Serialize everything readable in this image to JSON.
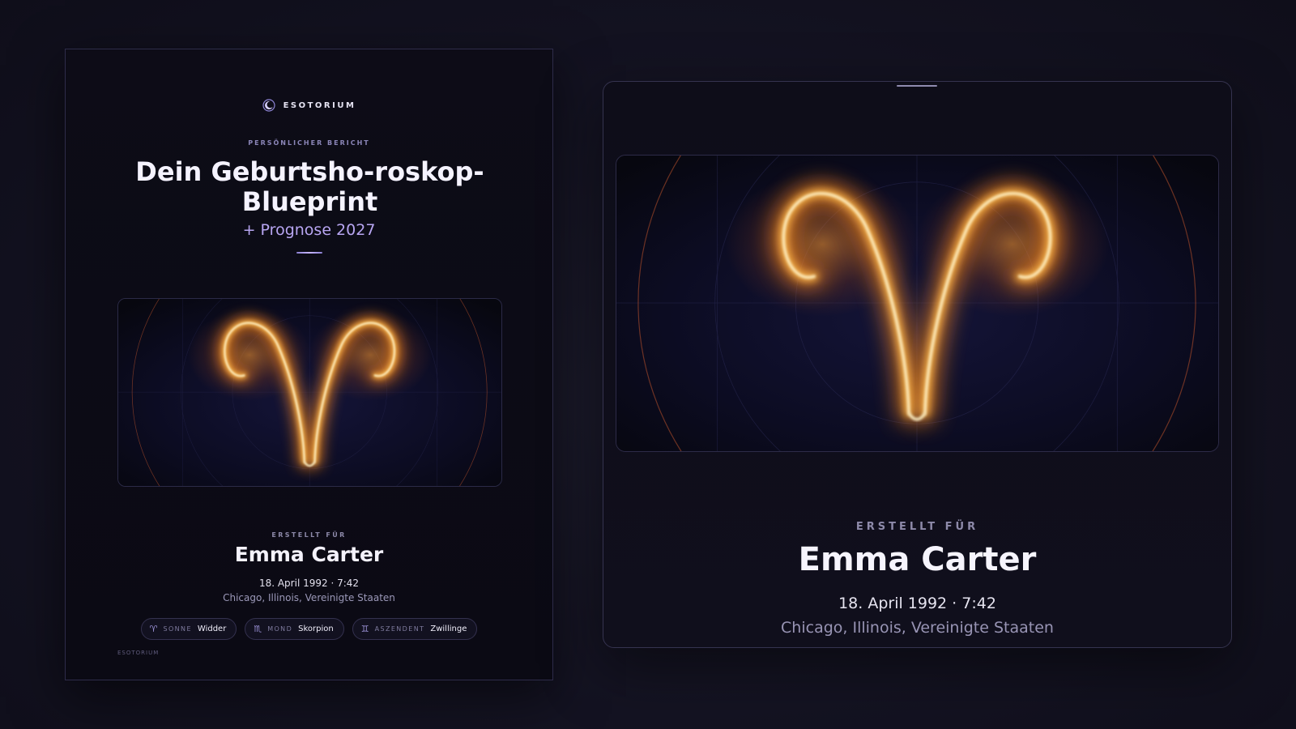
{
  "cover": {
    "brand": "ESOTORIUM",
    "eyebrow": "PERSÖNLICHER BERICHT",
    "title": "Dein Geburtsho-roskop-Blueprint",
    "subtitle": "+ Prognose 2027",
    "made_for_label": "ERSTELLT FÜR",
    "name": "Emma Carter",
    "birth_date": "18. April 1992 · 7:42",
    "birth_place": "Chicago, Illinois, Vereinigte Staaten",
    "placements": [
      {
        "icon": "aries-glyph-icon",
        "glyph": "♈",
        "label": "SONNE",
        "value": "Widder"
      },
      {
        "icon": "scorpio-glyph-icon",
        "glyph": "♏",
        "label": "MOND",
        "value": "Skorpion"
      },
      {
        "icon": "gemini-glyph-icon",
        "glyph": "♊",
        "label": "ASZENDENT",
        "value": "Zwillinge"
      }
    ],
    "footer_brand": "ESOTORIUM",
    "illustration": "glowing-aries-symbol"
  },
  "preview": {
    "illustration": "glowing-aries-symbol",
    "made_for_label": "ERSTELLT FÜR",
    "name": "Emma Carter",
    "birth_date": "18. April 1992 · 7:42",
    "birth_place": "Chicago, Illinois, Vereinigte Staaten"
  },
  "colors": {
    "background": "#141322",
    "card": "#0d0c17",
    "accent_purple": "#b8a6f2",
    "glow_orange": "#ff9a2e",
    "glow_core": "#fff3c8"
  }
}
